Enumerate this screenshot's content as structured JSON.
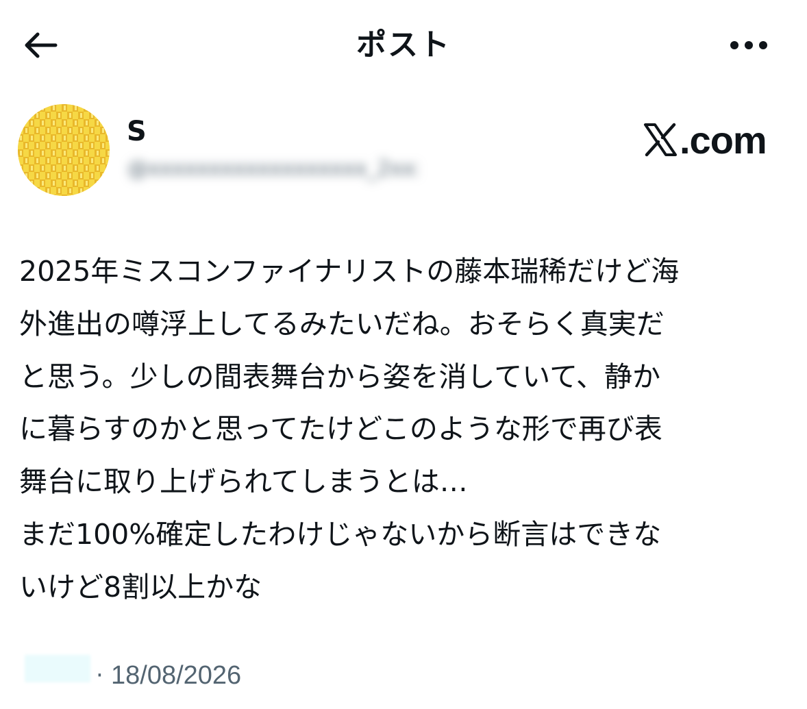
{
  "header": {
    "title": "ポスト",
    "back_icon": "arrow-left-icon",
    "more_icon": "more-horizontal-icon"
  },
  "author": {
    "display_name": "S",
    "handle_blurred": "@xxxxxxxxxxxxxxxxxx_2xxx",
    "avatar_color": "#f5d43a"
  },
  "watermark": {
    "text": ".com"
  },
  "post": {
    "lines": [
      "2025年ミスコンファイナリストの藤本瑞稀だけど海",
      "外進出の噂浮上してるみたいだね。おそらく真実だ",
      "と思う。少しの間表舞台から姿を消していて、静か",
      "に暮らすのかと思ってたけどこのような形で再び表",
      "舞台に取り上げられてしまうとは…",
      "まだ100%確定したわけじゃないから断言はできな",
      "いけど8割以上かな"
    ]
  },
  "footer": {
    "separator": "·",
    "date": "18/08/2026"
  },
  "colors": {
    "text": "#0f1419",
    "secondary": "#536471",
    "background": "#ffffff"
  }
}
